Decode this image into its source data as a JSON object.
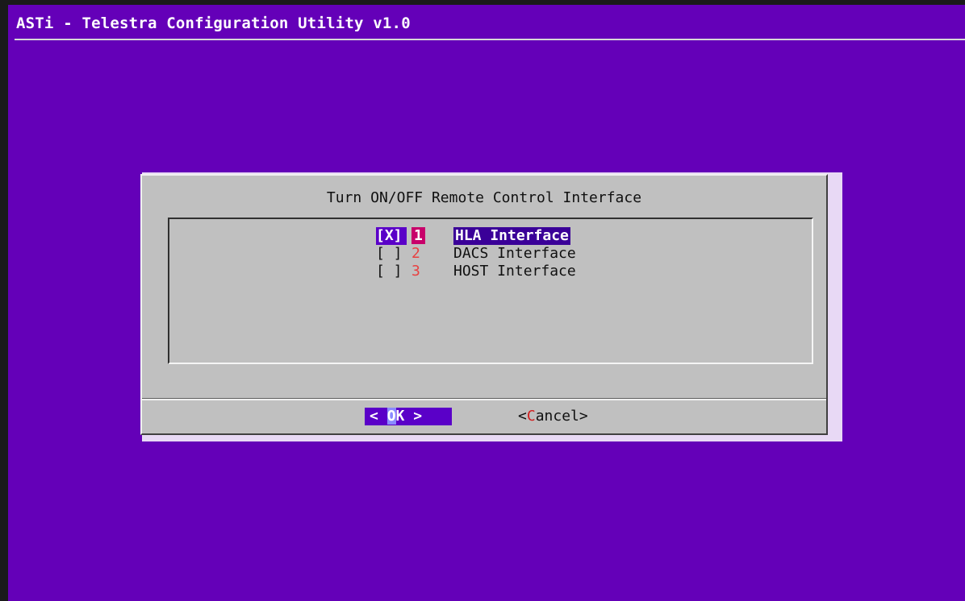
{
  "app": {
    "title": "ASTi - Telestra Configuration Utility v1.0"
  },
  "dialog": {
    "title": "Turn ON/OFF Remote Control Interface",
    "items": [
      {
        "check": "[X]",
        "tag": "1",
        "label": "HLA Interface",
        "selected": true
      },
      {
        "check": "[ ]",
        "tag": "2",
        "label": "DACS Interface",
        "selected": false
      },
      {
        "check": "[ ]",
        "tag": "3",
        "label": "HOST Interface",
        "selected": false
      }
    ],
    "buttons": {
      "ok": {
        "left": "<",
        "pre": " ",
        "hotkey": "O",
        "rest": "K",
        "right": " >"
      },
      "cancel": {
        "open": "<",
        "hotkey": "C",
        "rest": "ancel",
        "close": ">"
      }
    }
  },
  "colors": {
    "background": "#6400b8",
    "dialog": "#c0c0c0",
    "selection": "#5a00c8",
    "tag": "#e84040"
  }
}
